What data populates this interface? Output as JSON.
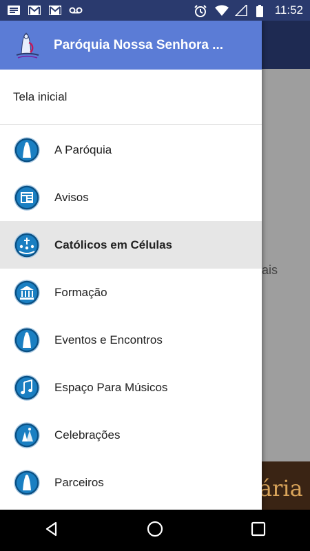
{
  "status_bar": {
    "time": "11:52",
    "left_icons": [
      "message-icon",
      "gmail-icon",
      "gmail-icon",
      "voicemail-icon"
    ],
    "right_icons": [
      "alarm-icon",
      "wifi-icon",
      "signal-icon",
      "battery-icon"
    ]
  },
  "drawer": {
    "title": "Paróquia Nossa Senhora ...",
    "home_label": "Tela inicial",
    "items": [
      {
        "label": "A Paróquia",
        "icon": "our-lady-statue-icon"
      },
      {
        "label": "Avisos",
        "icon": "notice-board-icon"
      },
      {
        "label": "Católicos em Células",
        "icon": "cell-group-icon"
      },
      {
        "label": "Formação",
        "icon": "formation-building-icon"
      },
      {
        "label": "Eventos e Encontros",
        "icon": "our-lady-statue-icon"
      },
      {
        "label": "Espaço Para Músicos",
        "icon": "music-note-icon"
      },
      {
        "label": "Celebrações",
        "icon": "celebration-icon"
      },
      {
        "label": "Parceiros",
        "icon": "our-lady-statue-icon"
      }
    ],
    "selected_index": 2,
    "header_color": "#5b7cd6"
  },
  "background": {
    "partial_text": "ais",
    "banner_text": "ária"
  },
  "nav_bar": {
    "buttons": [
      "back-icon",
      "home-icon",
      "recents-icon"
    ]
  }
}
